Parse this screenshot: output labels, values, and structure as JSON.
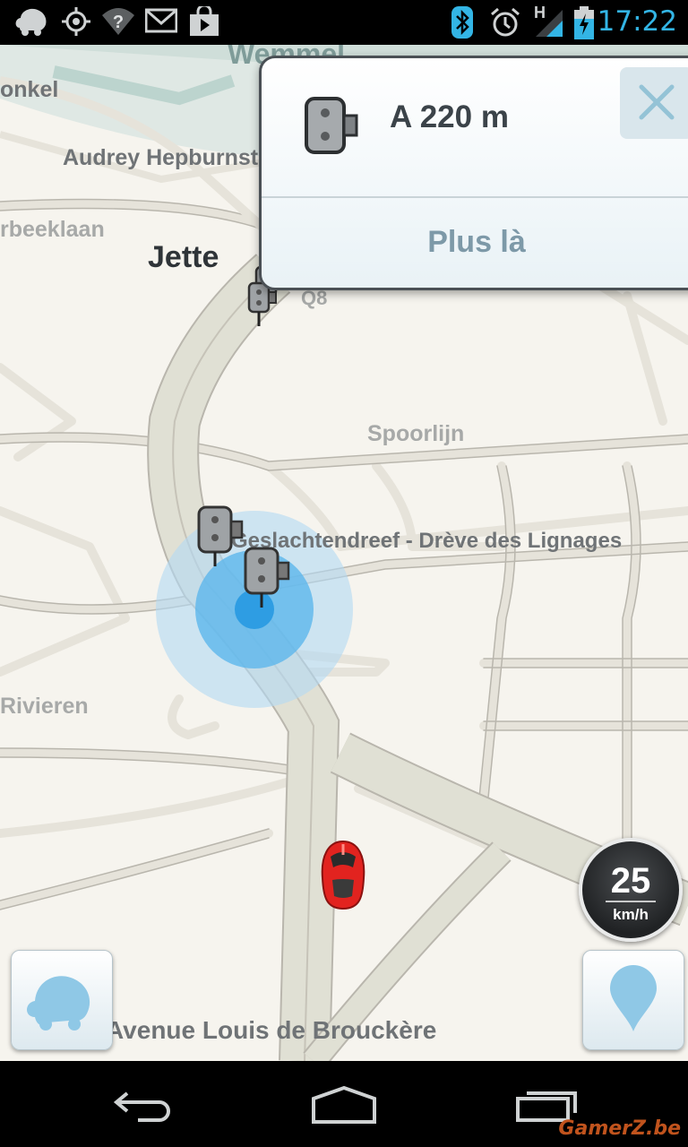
{
  "status_bar": {
    "time": "17:22",
    "network_label": "H",
    "icons": [
      "waze-notification-icon",
      "gps-icon",
      "wifi-unknown-icon",
      "gmail-icon",
      "play-store-icon",
      "bluetooth-icon",
      "alarm-icon",
      "signal-icon",
      "battery-charging-icon"
    ],
    "accent_color": "#33b5e5"
  },
  "map": {
    "labels": {
      "wemmel": "Wemmel",
      "onkel": "onkel",
      "audrey": "Audrey Hepburnstr",
      "beeklaan": "rbeeklaan",
      "jette": "Jette",
      "q8": "Q8",
      "spoorlijn": "Spoorlijn",
      "geslachtendreef": "Geslachtendreef - Drève des Lignages",
      "rivieren": "Rivieren",
      "avenue": "Avenue Louis de Brouckère"
    }
  },
  "alert": {
    "title": "A 220 m",
    "more_label": "Plus là",
    "icon": "speed-camera-icon",
    "close_icon": "close-icon"
  },
  "speedometer": {
    "value": "25",
    "unit": "km/h"
  },
  "buttons": {
    "left_icon": "waze-menu-icon",
    "right_icon": "location-pin-icon"
  },
  "nav_bar": {
    "icons": [
      "back-icon",
      "home-icon",
      "recent-apps-icon"
    ]
  },
  "watermark": "GamerZ.be"
}
